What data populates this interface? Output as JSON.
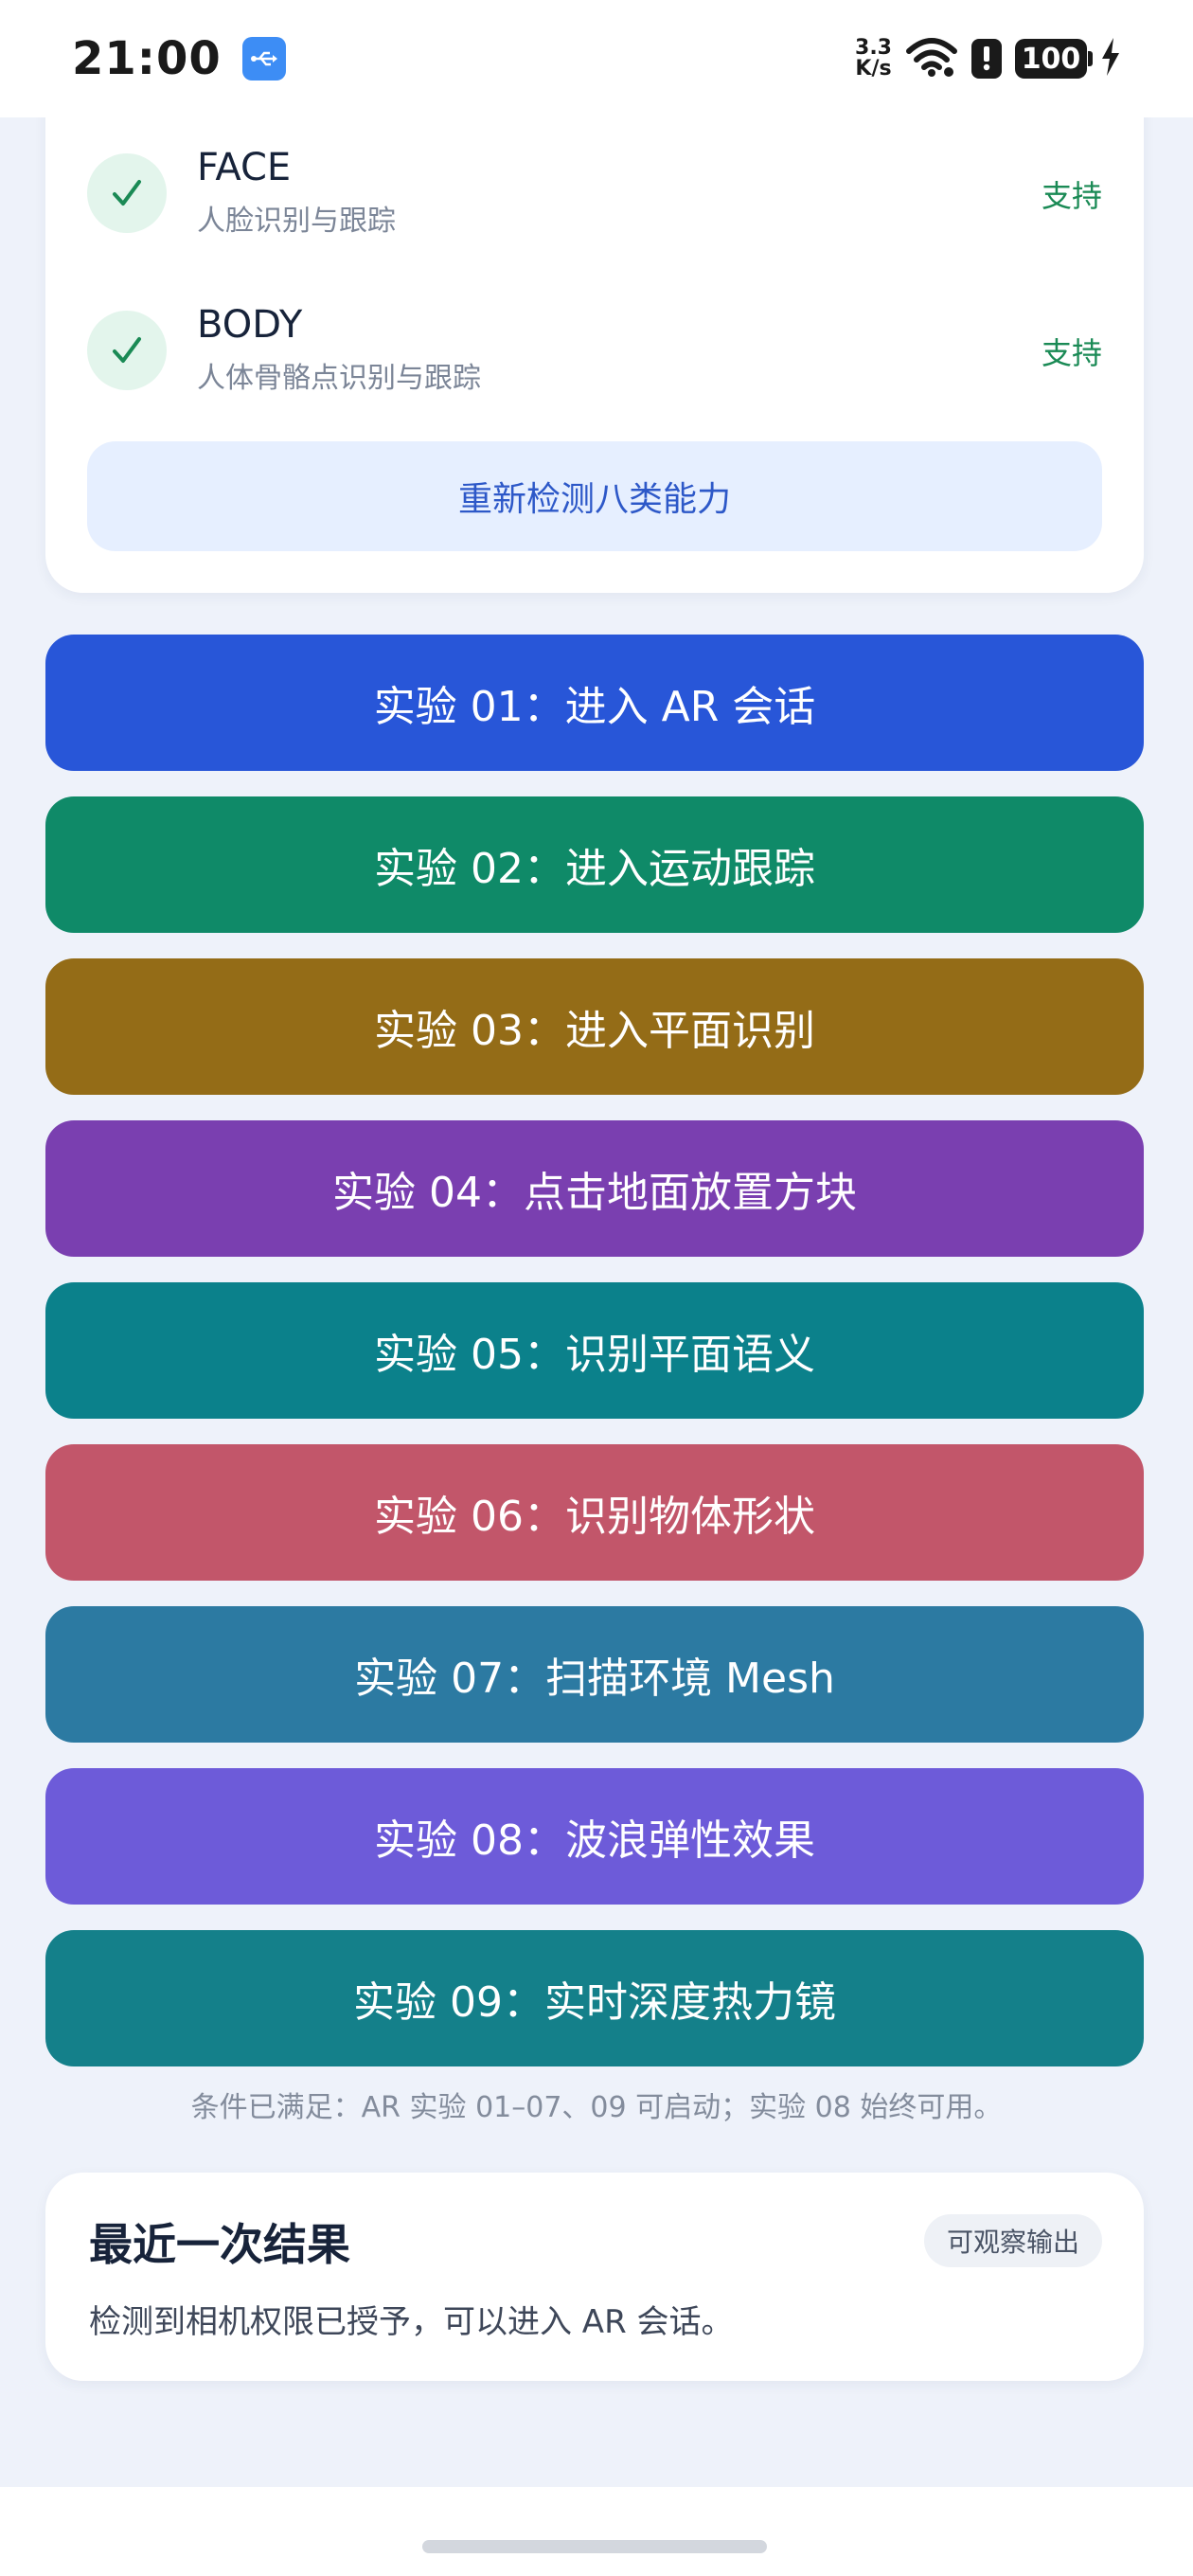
{
  "status_bar": {
    "time": "21:00",
    "net_speed_value": "3.3",
    "net_speed_unit": "K/s",
    "battery": "100",
    "icons": [
      "usb-icon",
      "wifi-icon",
      "alert-icon",
      "battery-icon",
      "charging-icon"
    ]
  },
  "capabilities": [
    {
      "name": "FACE",
      "desc": "人脸识别与跟踪",
      "status": "支持"
    },
    {
      "name": "BODY",
      "desc": "人体骨骼点识别与跟踪",
      "status": "支持"
    }
  ],
  "recheck_label": "重新检测八类能力",
  "experiments": [
    {
      "label": "实验 01：进入 AR 会话",
      "color": "#2856d8"
    },
    {
      "label": "实验 02：进入运动跟踪",
      "color": "#0f8a68"
    },
    {
      "label": "实验 03：进入平面识别",
      "color": "#946c17"
    },
    {
      "label": "实验 04：点击地面放置方块",
      "color": "#7a3fb0"
    },
    {
      "label": "实验 05：识别平面语义",
      "color": "#0b818b"
    },
    {
      "label": "实验 06：识别物体形状",
      "color": "#c2566a"
    },
    {
      "label": "实验 07：扫描环境 Mesh",
      "color": "#2c7aa2"
    },
    {
      "label": "实验 08：波浪弹性效果",
      "color": "#6d5bd9"
    },
    {
      "label": "实验 09：实时深度热力镜",
      "color": "#14808a"
    }
  ],
  "hint": "条件已满足：AR 实验 01–07、09 可启动；实验 08 始终可用。",
  "result": {
    "title": "最近一次结果",
    "badge": "可观察输出",
    "text": "检测到相机权限已授予，可以进入 AR 会话。"
  }
}
